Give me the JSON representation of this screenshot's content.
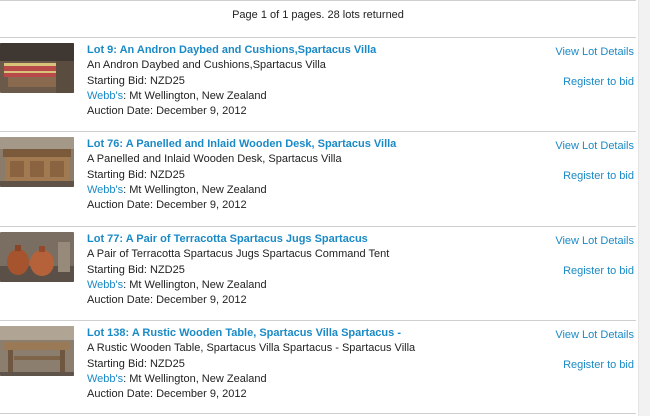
{
  "pager": {
    "summary": "Page 1 of 1 pages. 28 lots returned"
  },
  "lots": [
    {
      "title": "Lot 9: An Andron Daybed and Cushions,Spartacus Villa",
      "description": "An Andron Daybed and Cushions,Spartacus Villa",
      "starting_bid": "Starting Bid: NZD25",
      "auctioneer": "Webb's",
      "location": ": Mt Wellington, New Zealand",
      "auction_date": "Auction Date: December 9, 2012",
      "view_label": "View Lot Details",
      "register_label": "Register to bid"
    },
    {
      "title": "Lot 76: A Panelled and Inlaid Wooden Desk, Spartacus Villa",
      "description": "A Panelled and Inlaid Wooden Desk, Spartacus Villa",
      "starting_bid": "Starting Bid: NZD25",
      "auctioneer": "Webb's",
      "location": ": Mt Wellington, New Zealand",
      "auction_date": "Auction Date: December 9, 2012",
      "view_label": "View Lot Details",
      "register_label": "Register to bid"
    },
    {
      "title": "Lot 77: A Pair of Terracotta Spartacus Jugs Spartacus",
      "description": "A Pair of Terracotta Spartacus Jugs Spartacus Command Tent",
      "starting_bid": "Starting Bid: NZD25",
      "auctioneer": "Webb's",
      "location": ": Mt Wellington, New Zealand",
      "auction_date": "Auction Date: December 9, 2012",
      "view_label": "View Lot Details",
      "register_label": "Register to bid"
    },
    {
      "title": "Lot 138: A Rustic Wooden Table, Spartacus Villa Spartacus -",
      "description": "A Rustic Wooden Table, Spartacus Villa Spartacus - Spartacus Villa",
      "starting_bid": "Starting Bid: NZD25",
      "auctioneer": "Webb's",
      "location": ": Mt Wellington, New Zealand",
      "auction_date": "Auction Date: December 9, 2012",
      "view_label": "View Lot Details",
      "register_label": "Register to bid"
    }
  ],
  "colors": {
    "link": "#1a8ac6",
    "divider": "#cfcfcf",
    "text": "#222222"
  }
}
